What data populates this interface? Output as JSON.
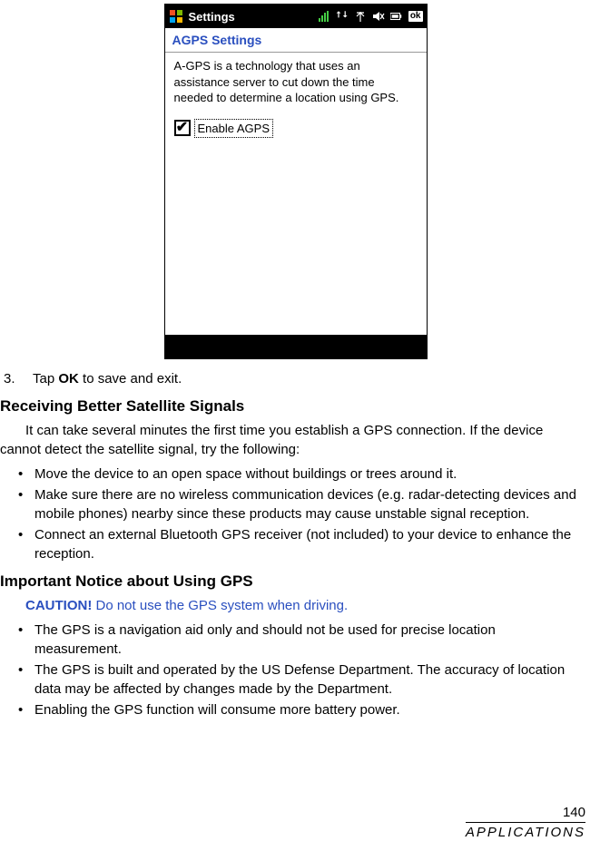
{
  "device": {
    "statusbar": {
      "title": "Settings",
      "ok": "ok"
    },
    "subheader": "AGPS Settings",
    "description": "A-GPS is a technology that uses an assistance server to cut down the time needed to determine a location using GPS.",
    "checkbox": {
      "checked": true,
      "label": "Enable AGPS"
    }
  },
  "step3": {
    "num": "3.",
    "pre": "Tap ",
    "bold": "OK",
    "post": " to save and exit."
  },
  "section1": {
    "heading": "Receiving Better Satellite Signals",
    "intro": "It can take several minutes the first time you establish a GPS connection. If the device cannot detect the satellite signal, try the following:",
    "bullets": [
      "Move the device to an open space without buildings or trees around it.",
      "Make sure there are no wireless communication devices (e.g. radar-detecting devices and mobile phones) nearby since these products may cause unstable signal reception.",
      "Connect an external Bluetooth GPS receiver (not included) to your device to enhance the reception."
    ]
  },
  "section2": {
    "heading": "Important Notice about Using GPS",
    "caution_label": "CAUTION!",
    "caution_text": " Do not use the GPS system when driving.",
    "bullets": [
      "The GPS is a navigation aid only and should not be used for precise location measurement.",
      "The GPS is built and operated by the US Defense Department. The accuracy of location data may be affected by changes made by the Department.",
      "Enabling the GPS function will consume more battery power."
    ]
  },
  "footer": {
    "page": "140",
    "label": "Applications"
  }
}
